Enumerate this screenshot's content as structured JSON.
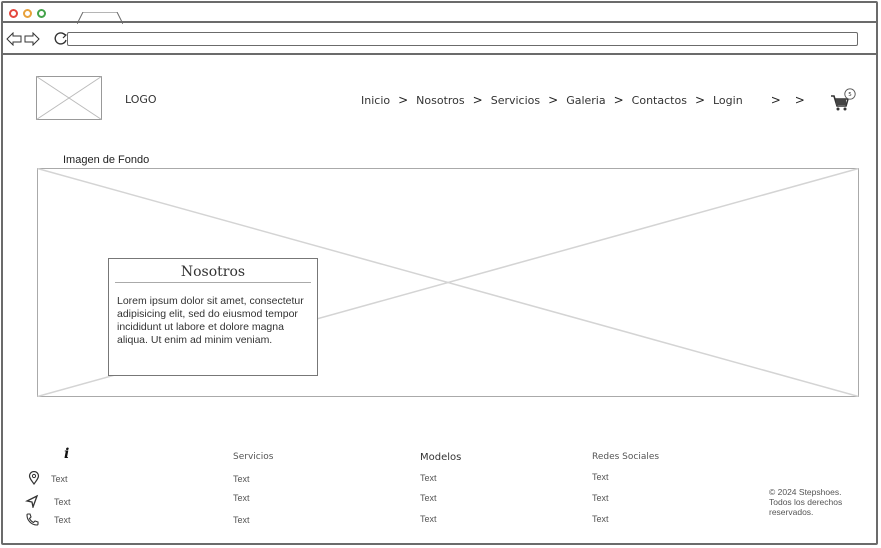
{
  "header": {
    "logo_text": "LOGO",
    "nav": [
      "Inicio",
      "Nosotros",
      "Servicios",
      "Galeria",
      "Contactos",
      "Login"
    ],
    "cart_count": "5"
  },
  "hero": {
    "background_label": "Imagen de Fondo",
    "card": {
      "title": "Nosotros",
      "body": "Lorem ipsum dolor sit amet, consectetur adipisicing elit, sed do eiusmod tempor incididunt ut labore et dolore magna aliqua. Ut enim ad minim veniam."
    }
  },
  "footer": {
    "info": {
      "items": [
        {
          "icon": "location-pin-icon",
          "text": "Text"
        },
        {
          "icon": "navigation-icon",
          "text": "Text"
        },
        {
          "icon": "phone-icon",
          "text": "Text"
        }
      ]
    },
    "servicios": {
      "title": "Servicios",
      "items": [
        "Text",
        "Text",
        "Text"
      ]
    },
    "modelos": {
      "title": "Modelos",
      "items": [
        "Text",
        "Text",
        "Text"
      ]
    },
    "redes": {
      "title": "Redes Sociales",
      "items": [
        "Text",
        "Text",
        "Text"
      ]
    },
    "copyright": "© 2024 Stepshoes. Todos los derechos reservados."
  },
  "colors": {
    "window_border": "#6b6b6b",
    "close": "#e4473e",
    "minimize": "#e8a13a",
    "maximize": "#44a34a",
    "placeholder_line": "#cfcfcf"
  }
}
